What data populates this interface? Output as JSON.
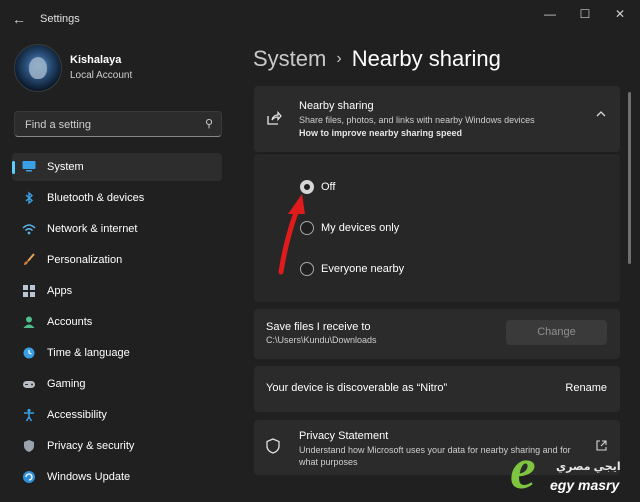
{
  "window": {
    "title": "Settings",
    "back_icon": "back-arrow-icon",
    "controls": [
      "minimize-icon",
      "maximize-icon",
      "close-icon"
    ]
  },
  "profile": {
    "name": "Kishalaya",
    "account_type": "Local Account"
  },
  "search": {
    "placeholder": "Find a setting",
    "value": ""
  },
  "sidebar": {
    "items": [
      {
        "label": "System",
        "icon": "system-icon",
        "selected": true
      },
      {
        "label": "Bluetooth & devices",
        "icon": "bluetooth-icon"
      },
      {
        "label": "Network & internet",
        "icon": "network-icon"
      },
      {
        "label": "Personalization",
        "icon": "paintbrush-icon"
      },
      {
        "label": "Apps",
        "icon": "apps-icon"
      },
      {
        "label": "Accounts",
        "icon": "accounts-icon"
      },
      {
        "label": "Time & language",
        "icon": "globe-clock-icon"
      },
      {
        "label": "Gaming",
        "icon": "gamepad-icon"
      },
      {
        "label": "Accessibility",
        "icon": "accessibility-icon"
      },
      {
        "label": "Privacy & security",
        "icon": "shield-icon"
      },
      {
        "label": "Windows Update",
        "icon": "update-icon"
      }
    ]
  },
  "breadcrumb": {
    "parent": "System",
    "separator": "›",
    "current": "Nearby sharing"
  },
  "nearby": {
    "title": "Nearby sharing",
    "description": "Share files, photos, and links with nearby Windows devices",
    "help_link": "How to improve nearby sharing speed",
    "expanded": true,
    "options": [
      {
        "label": "Off",
        "selected": true
      },
      {
        "label": "My devices only",
        "selected": false
      },
      {
        "label": "Everyone nearby",
        "selected": false
      }
    ]
  },
  "save_files": {
    "title": "Save files I receive to",
    "path": "C:\\Users\\Kundu\\Downloads",
    "button": "Change"
  },
  "discoverable": {
    "text": "Your device is discoverable as “Nitro”",
    "action": "Rename"
  },
  "privacy": {
    "title": "Privacy Statement",
    "description": "Understand how Microsoft uses your data for nearby sharing and for what purposes"
  },
  "watermark": {
    "arabic": "ايجي مصري",
    "latin": "egy masry"
  },
  "colors": {
    "accent": "#60cdff",
    "background": "#202020",
    "card": "#2b2b2b",
    "annotation_arrow": "#e01b1b",
    "watermark_green": "#7ec63f"
  }
}
